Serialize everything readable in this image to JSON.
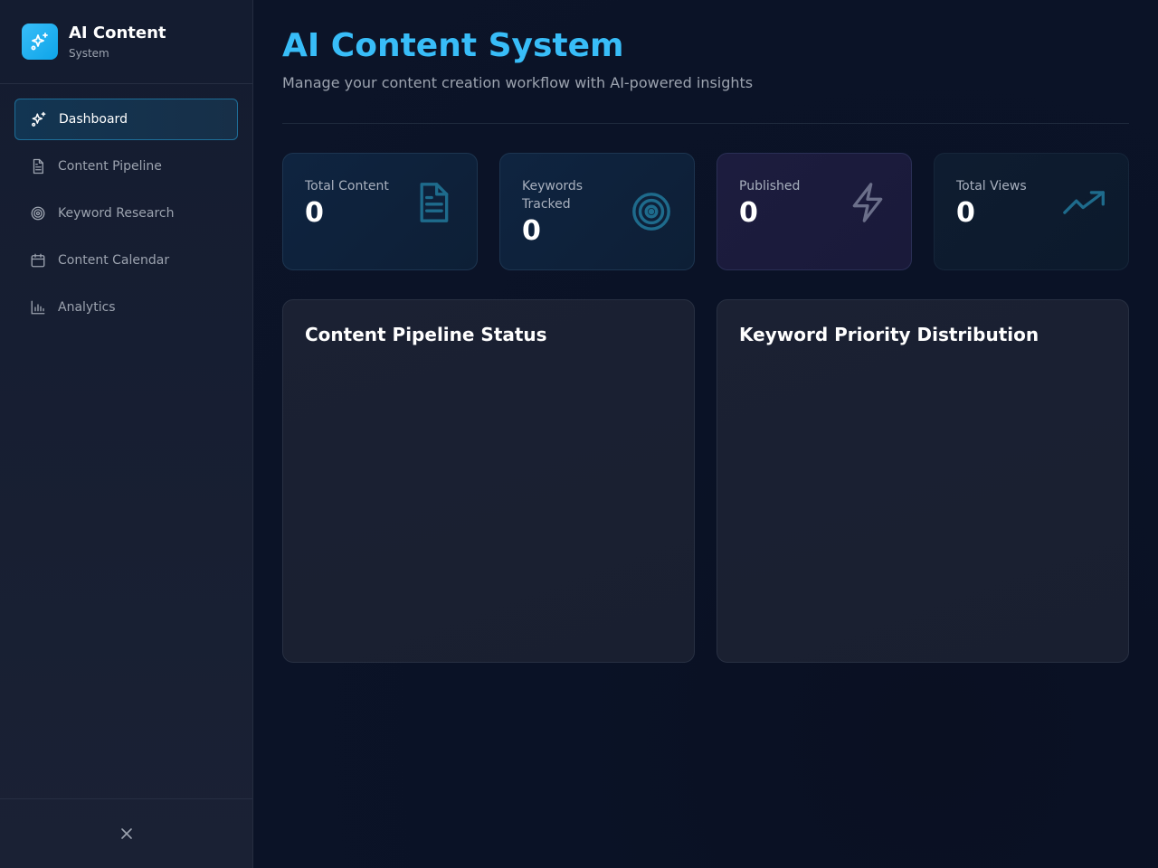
{
  "brand": {
    "title": "AI Content",
    "subtitle": "System"
  },
  "nav": [
    {
      "label": "Dashboard",
      "icon": "sparkles-icon",
      "active": true
    },
    {
      "label": "Content Pipeline",
      "icon": "document-icon",
      "active": false
    },
    {
      "label": "Keyword Research",
      "icon": "target-icon",
      "active": false
    },
    {
      "label": "Content Calendar",
      "icon": "calendar-icon",
      "active": false
    },
    {
      "label": "Analytics",
      "icon": "bar-chart-icon",
      "active": false
    }
  ],
  "header": {
    "title": "AI Content System",
    "subtitle": "Manage your content creation workflow with AI-powered insights"
  },
  "stats": [
    {
      "label": "Total Content",
      "value": "0",
      "icon": "document-icon"
    },
    {
      "label": "Keywords Tracked",
      "value": "0",
      "icon": "target-icon"
    },
    {
      "label": "Published",
      "value": "0",
      "icon": "lightning-icon"
    },
    {
      "label": "Total Views",
      "value": "0",
      "icon": "trending-up-icon"
    }
  ],
  "panels": [
    {
      "title": "Content Pipeline Status"
    },
    {
      "title": "Keyword Priority Distribution"
    }
  ],
  "colors": {
    "accent": "#38bdf8",
    "background": "#0b1224",
    "sidebar": "#141c30",
    "active_border": "#1e6e98",
    "icon_teal": "#1e6b8c",
    "icon_purple": "#6b6f8a"
  }
}
